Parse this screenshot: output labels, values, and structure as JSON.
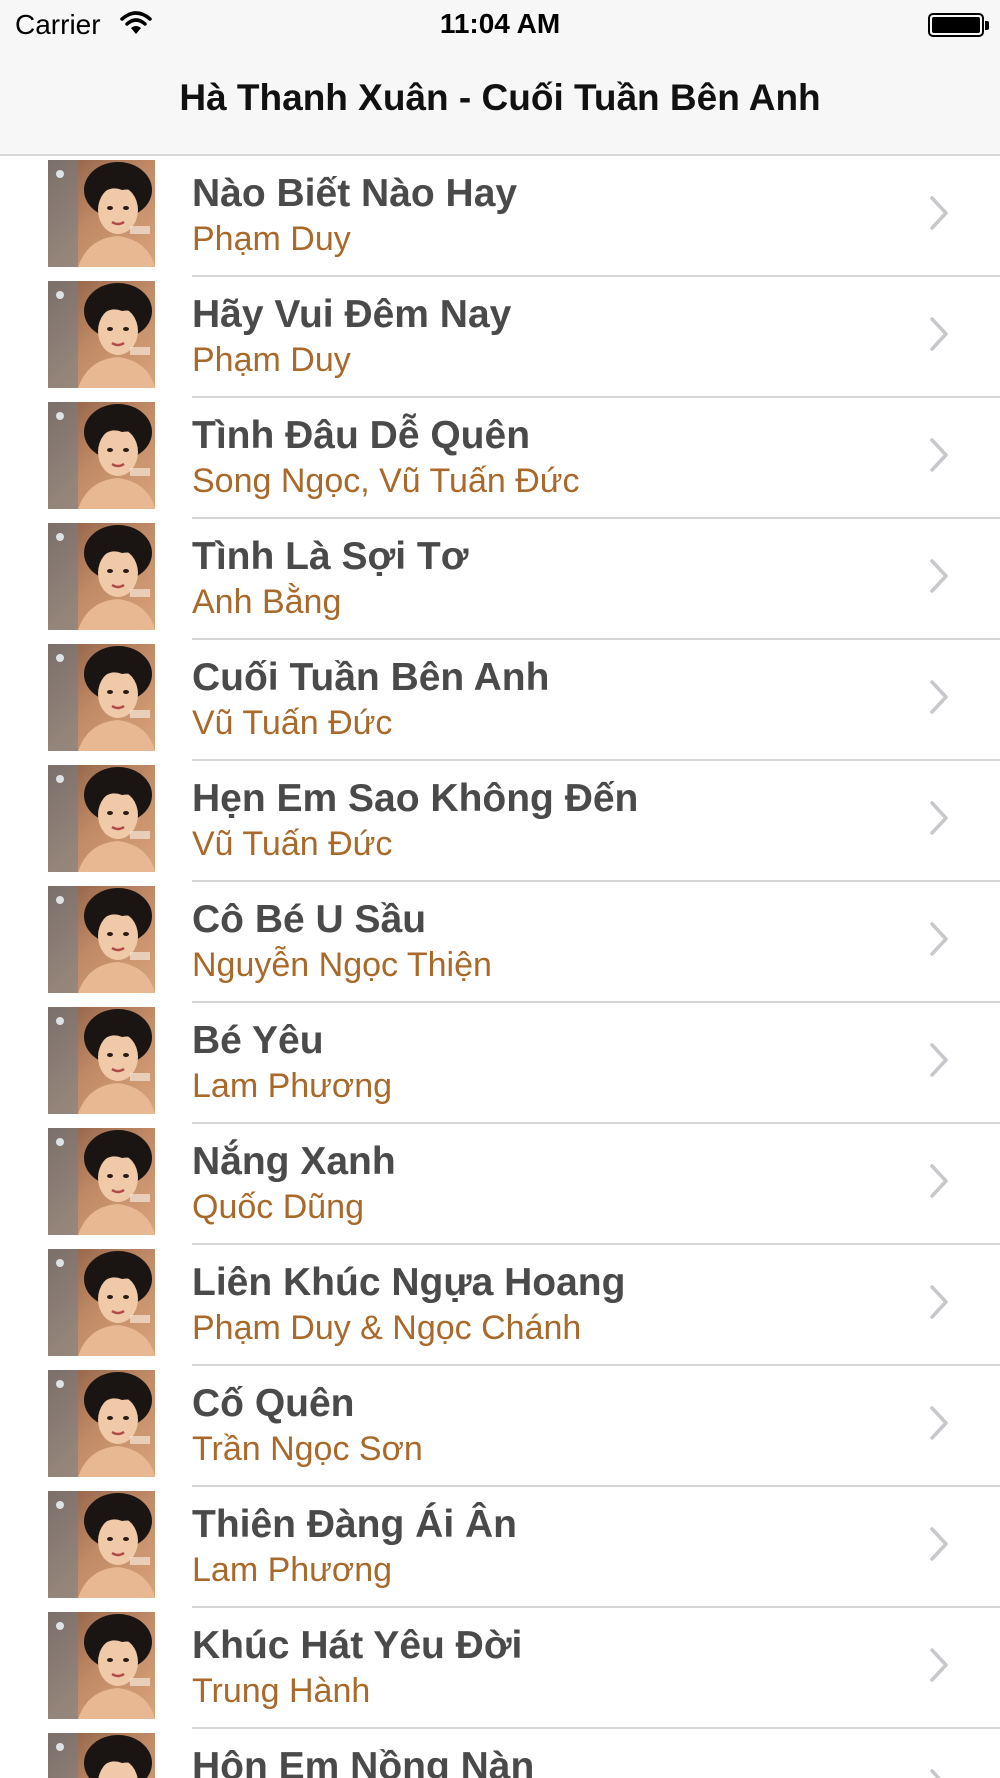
{
  "status_bar": {
    "carrier": "Carrier",
    "time": "11:04 AM",
    "icons": [
      "wifi-icon",
      "battery-icon"
    ]
  },
  "nav": {
    "title": "Hà Thanh Xuân - Cuối Tuần Bên Anh"
  },
  "colors": {
    "title_text": "#4a4a4a",
    "artist_text": "#a8692a",
    "separator": "#d6d6d6",
    "nav_background": "#f7f7f7"
  },
  "songs": [
    {
      "title": "Nào Biết Nào Hay",
      "artist": "Phạm Duy"
    },
    {
      "title": "Hãy Vui Đêm Nay",
      "artist": "Phạm Duy"
    },
    {
      "title": "Tình Đâu Dễ Quên",
      "artist": "Song Ngọc, Vũ Tuấn Đức"
    },
    {
      "title": "Tình Là Sợi Tơ",
      "artist": "Anh Bằng"
    },
    {
      "title": "Cuối Tuần Bên Anh",
      "artist": "Vũ Tuấn Đức"
    },
    {
      "title": "Hẹn Em Sao Không Đến",
      "artist": "Vũ Tuấn Đức"
    },
    {
      "title": "Cô Bé U Sầu",
      "artist": "Nguyễn Ngọc Thiện"
    },
    {
      "title": "Bé Yêu",
      "artist": "Lam Phương"
    },
    {
      "title": "Nắng Xanh",
      "artist": "Quốc Dũng"
    },
    {
      "title": "Liên Khúc Ngựa Hoang",
      "artist": "Phạm Duy & Ngọc Chánh"
    },
    {
      "title": "Cố Quên",
      "artist": "Trần Ngọc Sơn"
    },
    {
      "title": "Thiên Đàng Ái Ân",
      "artist": "Lam Phương"
    },
    {
      "title": "Khúc Hát Yêu Đời",
      "artist": "Trung Hành"
    },
    {
      "title": "Hôn Em Nồng Nàn",
      "artist": ""
    }
  ]
}
